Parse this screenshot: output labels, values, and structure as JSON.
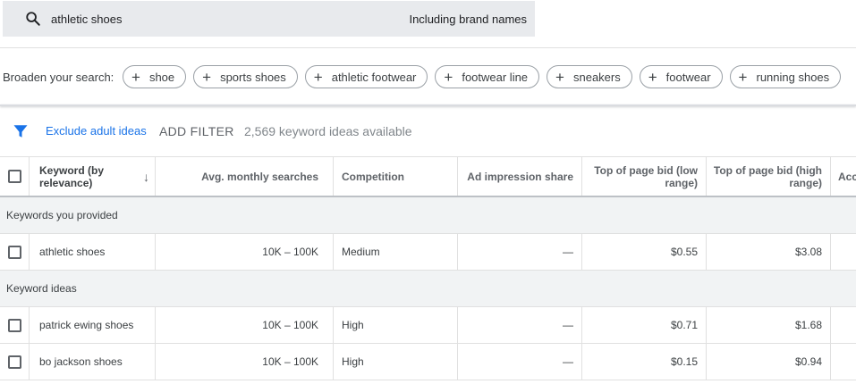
{
  "search": {
    "query": "athletic shoes",
    "brand_option": "Including brand names",
    "icon": "search-icon"
  },
  "broaden": {
    "label": "Broaden your search:",
    "chips": [
      "shoe",
      "sports shoes",
      "athletic footwear",
      "footwear line",
      "sneakers",
      "footwear",
      "running shoes"
    ]
  },
  "filter": {
    "icon": "filter-icon",
    "exclude_label": "Exclude adult ideas",
    "add_filter_label": "ADD FILTER",
    "ideas_available": "2,569 keyword ideas available"
  },
  "table": {
    "headers": {
      "keyword": "Keyword (by relevance)",
      "avg_monthly": "Avg. monthly searches",
      "competition": "Competition",
      "ad_impression": "Ad impression share",
      "bid_low": "Top of page bid (low range)",
      "bid_high": "Top of page bid (high range)",
      "account": "Account status"
    },
    "sort_icon": "arrow-down-icon",
    "groups": [
      {
        "label": "Keywords you provided",
        "rows": [
          {
            "keyword": "athletic shoes",
            "avg": "10K – 100K",
            "competition": "Medium",
            "impression": "—",
            "low": "$0.55",
            "high": "$3.08"
          }
        ]
      },
      {
        "label": "Keyword ideas",
        "rows": [
          {
            "keyword": "patrick ewing shoes",
            "avg": "10K – 100K",
            "competition": "High",
            "impression": "—",
            "low": "$0.71",
            "high": "$1.68"
          },
          {
            "keyword": "bo jackson shoes",
            "avg": "10K – 100K",
            "competition": "High",
            "impression": "—",
            "low": "$0.15",
            "high": "$0.94"
          }
        ]
      }
    ]
  },
  "colors": {
    "accent": "#1a73e8",
    "search_bg": "#e8eaed",
    "group_bg": "#f1f3f4"
  }
}
